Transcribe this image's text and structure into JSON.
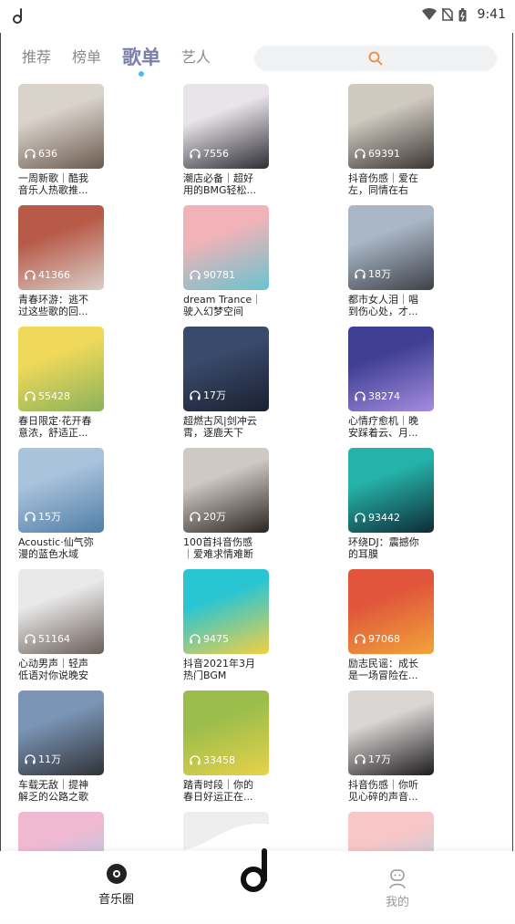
{
  "status": {
    "time": "9:41"
  },
  "tabs": [
    {
      "label": "推荐",
      "active": false
    },
    {
      "label": "榜单",
      "active": false
    },
    {
      "label": "歌单",
      "active": true
    },
    {
      "label": "艺人",
      "active": false
    }
  ],
  "search": {
    "icon": "search-icon",
    "accent": "#f08a3c"
  },
  "playlists": [
    {
      "plays": "636",
      "title": "一周新歌｜酷我\n音乐人热歌推...",
      "c1": "#d9d3cc",
      "c2": "#6b5a4e"
    },
    {
      "plays": "7556",
      "title": "潮店必备｜超好\n用的BMG轻松...",
      "c1": "#e8e4ea",
      "c2": "#2d2d33"
    },
    {
      "plays": "69391",
      "title": "抖音伤感｜爱在\n左，同情在右",
      "c1": "#cfc9c0",
      "c2": "#3b3634"
    },
    {
      "plays": "41366",
      "title": "青春环游：逃不\n过这些歌的回...",
      "c1": "#b85a48",
      "c2": "#d8cfc8"
    },
    {
      "plays": "90781",
      "title": "dream Trance｜\n驶入幻梦空间",
      "c1": "#f2b3b8",
      "c2": "#68c3cf"
    },
    {
      "plays": "18万",
      "title": "都市女人泪｜唱\n到伤心处，才...",
      "c1": "#a9b7c6",
      "c2": "#3e4049"
    },
    {
      "plays": "55428",
      "title": "春日限定·花开春\n意浓，舒适正...",
      "c1": "#f0d95a",
      "c2": "#8ab25b"
    },
    {
      "plays": "17万",
      "title": "超燃古风|剑冲云\n霄，逐鹿天下",
      "c1": "#3a4a6b",
      "c2": "#1a2030"
    },
    {
      "plays": "38274",
      "title": "心情疗愈机｜晚\n安踩着云、月...",
      "c1": "#3f3f93",
      "c2": "#a68de0"
    },
    {
      "plays": "15万",
      "title": "Acoustic·仙气弥\n漫的蓝色水域",
      "c1": "#a9c3dc",
      "c2": "#4f7ea6"
    },
    {
      "plays": "20万",
      "title": "100首抖音伤感\n｜爱难求情难断",
      "c1": "#cfc9c4",
      "c2": "#2a2422"
    },
    {
      "plays": "93442",
      "title": "环绕DJ：震撼你\n的耳膜",
      "c1": "#25b2a8",
      "c2": "#0f2b36"
    },
    {
      "plays": "51164",
      "title": "心动男声｜轻声\n低语对你说晚安",
      "c1": "#e9e9ea",
      "c2": "#6b5e57"
    },
    {
      "plays": "9475",
      "title": "抖音2021年3月\n热门BGM",
      "c1": "#2ac5d3",
      "c2": "#f4d043"
    },
    {
      "plays": "97068",
      "title": "励志民谣：成长\n是一场冒险在...",
      "c1": "#e0553b",
      "c2": "#f2a43a"
    },
    {
      "plays": "11万",
      "title": "车载无敌｜提神\n解乏的公路之歌",
      "c1": "#7b95b6",
      "c2": "#2f3238"
    },
    {
      "plays": "33458",
      "title": "踏青时段｜你的\n春日好运正在...",
      "c1": "#9bbd4b",
      "c2": "#e8d24a"
    },
    {
      "plays": "17万",
      "title": "抖音伤感｜你听\n见心碎的声音...",
      "c1": "#d9d6d4",
      "c2": "#1e1c1e"
    },
    {
      "plays": "",
      "title": "",
      "c1": "#f0b9d2",
      "c2": "#8fd1e8"
    },
    {
      "plays": "",
      "title": "",
      "c1": "#eeeeee",
      "c2": "#dddddd"
    },
    {
      "plays": "",
      "title": "",
      "c1": "#f7c6c6",
      "c2": "#9ed0f0"
    }
  ],
  "bottom_nav": {
    "left_label": "音乐圈",
    "right_label": "我的"
  }
}
